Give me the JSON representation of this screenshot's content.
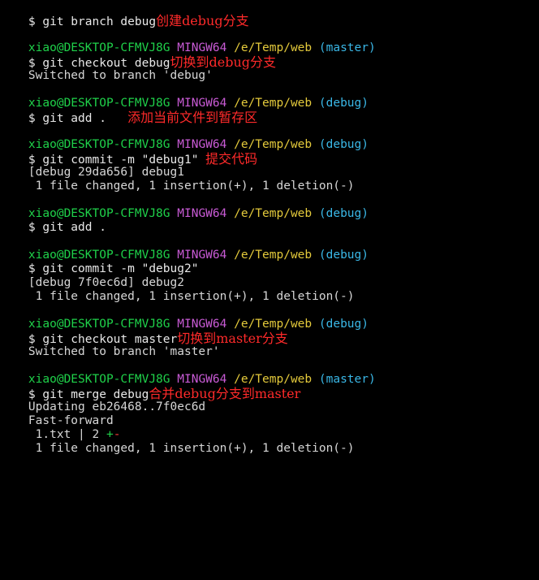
{
  "terminal": {
    "lines": [
      {
        "kind": "cmd",
        "text": "$ git branch debug",
        "note": "创建debug分支"
      },
      {
        "kind": "prompt",
        "user": "xiao@DESKTOP-CFMVJ8G",
        "env": "MINGW64",
        "path": "/e/Temp/web",
        "branch": "(master)"
      },
      {
        "kind": "cmd",
        "text": "$ git checkout debug",
        "note": "切换到debug分支"
      },
      {
        "kind": "out",
        "text": "Switched to branch 'debug'"
      },
      {
        "kind": "prompt",
        "user": "xiao@DESKTOP-CFMVJ8G",
        "env": "MINGW64",
        "path": "/e/Temp/web",
        "branch": "(debug)"
      },
      {
        "kind": "cmd",
        "text": "$ git add .",
        "note": "添加当前文件到暂存区"
      },
      {
        "kind": "prompt",
        "user": "xiao@DESKTOP-CFMVJ8G",
        "env": "MINGW64",
        "path": "/e/Temp/web",
        "branch": "(debug)"
      },
      {
        "kind": "cmd",
        "text": "$ git commit -m \"debug1\"",
        "note": "提交代码"
      },
      {
        "kind": "out",
        "text": "[debug 29da656] debug1"
      },
      {
        "kind": "out",
        "text": " 1 file changed, 1 insertion(+), 1 deletion(-)"
      },
      {
        "kind": "prompt",
        "user": "xiao@DESKTOP-CFMVJ8G",
        "env": "MINGW64",
        "path": "/e/Temp/web",
        "branch": "(debug)"
      },
      {
        "kind": "cmd",
        "text": "$ git add ."
      },
      {
        "kind": "prompt",
        "user": "xiao@DESKTOP-CFMVJ8G",
        "env": "MINGW64",
        "path": "/e/Temp/web",
        "branch": "(debug)"
      },
      {
        "kind": "cmd",
        "text": "$ git commit -m \"debug2\""
      },
      {
        "kind": "out",
        "text": "[debug 7f0ec6d] debug2"
      },
      {
        "kind": "out",
        "text": " 1 file changed, 1 insertion(+), 1 deletion(-)"
      },
      {
        "kind": "prompt",
        "user": "xiao@DESKTOP-CFMVJ8G",
        "env": "MINGW64",
        "path": "/e/Temp/web",
        "branch": "(debug)"
      },
      {
        "kind": "cmd",
        "text": "$ git checkout master",
        "note": "切换到master分支"
      },
      {
        "kind": "out",
        "text": "Switched to branch 'master'"
      },
      {
        "kind": "prompt",
        "user": "xiao@DESKTOP-CFMVJ8G",
        "env": "MINGW64",
        "path": "/e/Temp/web",
        "branch": "(master)"
      },
      {
        "kind": "cmd",
        "text": "$ git merge debug",
        "note": "合并debug分支到master"
      },
      {
        "kind": "out",
        "text": "Updating eb26468..7f0ec6d"
      },
      {
        "kind": "out",
        "text": "Fast-forward"
      },
      {
        "kind": "diffstat",
        "file": " 1.txt | 2 ",
        "plus": "+",
        "minus": "-"
      },
      {
        "kind": "out",
        "text": " 1 file changed, 1 insertion(+), 1 deletion(-)"
      }
    ]
  },
  "colors": {
    "background": "#000000",
    "user": "#1fd14a",
    "env": "#c95bd6",
    "path": "#e3c93b",
    "branch": "#3ab7e6",
    "note": "#ff2a2a"
  }
}
